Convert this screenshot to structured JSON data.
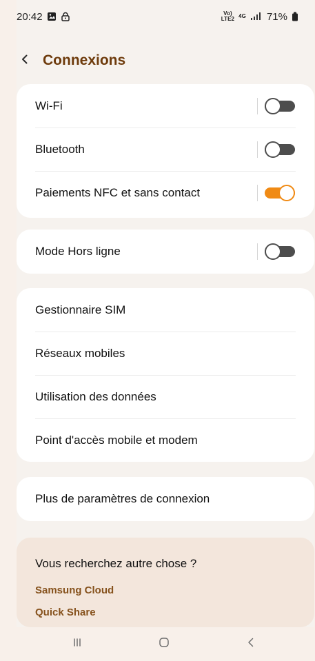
{
  "status_bar": {
    "time": "20:42",
    "network_top": "Vo)",
    "network_bottom": "LTE2",
    "network_4g": "4G",
    "battery": "71%",
    "icons": [
      "gallery-icon",
      "lock-icon",
      "signal-icon",
      "battery-icon"
    ]
  },
  "header": {
    "title": "Connexions",
    "back_icon": "chevron-left-icon"
  },
  "group1": {
    "items": [
      {
        "label": "Wi-Fi",
        "toggle": false
      },
      {
        "label": "Bluetooth",
        "toggle": false
      },
      {
        "label": "Paiements NFC et sans contact",
        "toggle": true
      }
    ]
  },
  "group2": {
    "items": [
      {
        "label": "Mode Hors ligne",
        "toggle": false
      }
    ]
  },
  "group3": {
    "items": [
      {
        "label": "Gestionnaire SIM"
      },
      {
        "label": "Réseaux mobiles"
      },
      {
        "label": "Utilisation des données"
      },
      {
        "label": "Point d'accès mobile et modem"
      }
    ]
  },
  "group4": {
    "items": [
      {
        "label": "Plus de paramètres de connexion"
      }
    ]
  },
  "suggestions": {
    "title": "Vous recherchez autre chose ?",
    "links": [
      "Samsung Cloud",
      "Quick Share"
    ]
  },
  "navigation": {
    "icons": [
      "recent-apps-icon",
      "home-icon",
      "back-icon"
    ]
  },
  "colors": {
    "accent": "#f08a14",
    "title": "#6e3b0c",
    "link": "#86521d",
    "background": "#f8f0ea",
    "card": "#ffffff"
  }
}
